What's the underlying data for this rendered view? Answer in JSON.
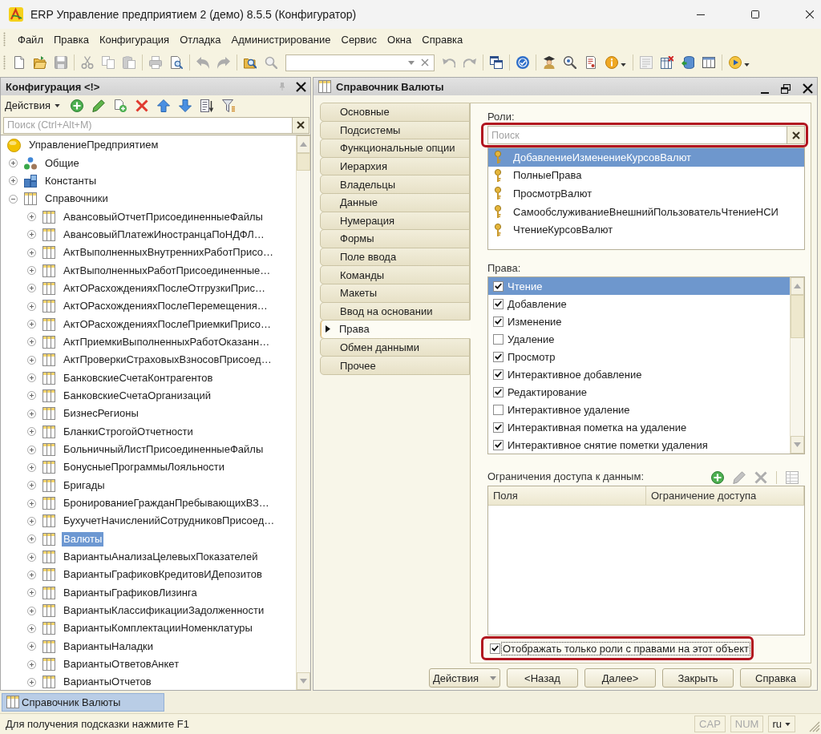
{
  "window": {
    "title": "ERP Управление предприятием 2 (демо) 8.5.5 (Конфигуратор)"
  },
  "menu": [
    "Файл",
    "Правка",
    "Конфигурация",
    "Отладка",
    "Администрирование",
    "Сервис",
    "Окна",
    "Справка"
  ],
  "toolbar": [
    [
      {
        "kind": "new",
        "disabled": false
      },
      {
        "kind": "open",
        "disabled": false
      },
      {
        "kind": "save",
        "disabled": true
      }
    ],
    [
      {
        "kind": "cut",
        "disabled": true
      },
      {
        "kind": "copy",
        "disabled": true
      },
      {
        "kind": "paste",
        "disabled": true
      }
    ],
    [
      {
        "kind": "print",
        "disabled": true
      },
      {
        "kind": "preview",
        "disabled": false
      }
    ],
    [
      {
        "kind": "undo",
        "disabled": true
      },
      {
        "kind": "redo",
        "disabled": true
      }
    ],
    [
      {
        "kind": "find_in_folder",
        "disabled": false
      },
      {
        "kind": "search",
        "disabled": true
      },
      {
        "kind": "combo",
        "disabled": false
      },
      {
        "kind": "find_prev",
        "disabled": true
      },
      {
        "kind": "find_next",
        "disabled": true
      }
    ],
    [
      {
        "kind": "windows",
        "disabled": false
      }
    ],
    [
      {
        "kind": "check",
        "disabled": false
      }
    ],
    [
      {
        "kind": "assistant",
        "disabled": false
      },
      {
        "kind": "help_search",
        "disabled": false
      },
      {
        "kind": "document",
        "disabled": false
      },
      {
        "kind": "info",
        "disabled": false
      },
      {
        "kind": "caret",
        "disabled": false
      }
    ],
    [
      {
        "kind": "module",
        "disabled": true
      },
      {
        "kind": "table_delete",
        "disabled": false
      },
      {
        "kind": "database",
        "disabled": false
      },
      {
        "kind": "form",
        "disabled": false
      }
    ],
    [
      {
        "kind": "play",
        "disabled": false
      },
      {
        "kind": "caret",
        "disabled": false
      }
    ]
  ],
  "config_panel": {
    "title": "Конфигурация <!>",
    "actions": "Действия",
    "toolbar": [
      {
        "kind": "add"
      },
      {
        "kind": "edit"
      },
      {
        "kind": "copy_add"
      },
      {
        "kind": "delete"
      },
      {
        "kind": "up"
      },
      {
        "kind": "down"
      },
      {
        "kind": "sort"
      },
      {
        "kind": "filter"
      }
    ],
    "search": {
      "placeholder": "Поиск (Ctrl+Alt+M)"
    },
    "tree": [
      {
        "label": "УправлениеПредприятием",
        "kind": "root",
        "selected": false,
        "children": [
          {
            "label": "Общие",
            "kind": "common",
            "expanded": false,
            "selected": false
          },
          {
            "label": "Константы",
            "kind": "constants",
            "expanded": false,
            "selected": false
          },
          {
            "label": "Справочники",
            "kind": "catalogs",
            "expanded": true,
            "selected": false,
            "children": [
              {
                "label": "АвансовыйОтчетПрисоединенныеФайлы",
                "kind": "catalog",
                "expanded": false,
                "selected": false
              },
              {
                "label": "АвансовыйПлатежИностранцаПоНДФЛ…",
                "kind": "catalog",
                "expanded": false,
                "selected": false
              },
              {
                "label": "АктВыполненныхВнутреннихРаботПрисо…",
                "kind": "catalog",
                "expanded": false,
                "selected": false
              },
              {
                "label": "АктВыполненныхРаботПрисоединенные…",
                "kind": "catalog",
                "expanded": false,
                "selected": false
              },
              {
                "label": "АктОРасхожденияхПослеОтгрузкиПрис…",
                "kind": "catalog",
                "expanded": false,
                "selected": false
              },
              {
                "label": "АктОРасхожденияхПослеПеремещения…",
                "kind": "catalog",
                "expanded": false,
                "selected": false
              },
              {
                "label": "АктОРасхожденияхПослеПриемкиПрисо…",
                "kind": "catalog",
                "expanded": false,
                "selected": false
              },
              {
                "label": "АктПриемкиВыполненныхРаботОказанн…",
                "kind": "catalog",
                "expanded": false,
                "selected": false
              },
              {
                "label": "АктПроверкиСтраховыхВзносовПрисоед…",
                "kind": "catalog",
                "expanded": false,
                "selected": false
              },
              {
                "label": "БанковскиеСчетаКонтрагентов",
                "kind": "catalog",
                "expanded": false,
                "selected": false
              },
              {
                "label": "БанковскиеСчетаОрганизаций",
                "kind": "catalog",
                "expanded": false,
                "selected": false
              },
              {
                "label": "БизнесРегионы",
                "kind": "catalog",
                "expanded": false,
                "selected": false
              },
              {
                "label": "БланкиСтрогойОтчетности",
                "kind": "catalog",
                "expanded": false,
                "selected": false
              },
              {
                "label": "БольничныйЛистПрисоединенныеФайлы",
                "kind": "catalog",
                "expanded": false,
                "selected": false
              },
              {
                "label": "БонусныеПрограммыЛояльности",
                "kind": "catalog",
                "expanded": false,
                "selected": false
              },
              {
                "label": "Бригады",
                "kind": "catalog",
                "expanded": false,
                "selected": false
              },
              {
                "label": "БронированиеГражданПребывающихВЗ…",
                "kind": "catalog",
                "expanded": false,
                "selected": false
              },
              {
                "label": "БухучетНачисленийСотрудниковПрисоед…",
                "kind": "catalog",
                "expanded": false,
                "selected": false
              },
              {
                "label": "Валюты",
                "kind": "catalog",
                "expanded": false,
                "selected": true
              },
              {
                "label": "ВариантыАнализаЦелевыхПоказателей",
                "kind": "catalog",
                "expanded": false,
                "selected": false
              },
              {
                "label": "ВариантыГрафиковКредитовИДепозитов",
                "kind": "catalog",
                "expanded": false,
                "selected": false
              },
              {
                "label": "ВариантыГрафиковЛизинга",
                "kind": "catalog",
                "expanded": false,
                "selected": false
              },
              {
                "label": "ВариантыКлассификацииЗадолженности",
                "kind": "catalog",
                "expanded": false,
                "selected": false
              },
              {
                "label": "ВариантыКомплектацииНоменклатуры",
                "kind": "catalog",
                "expanded": false,
                "selected": false
              },
              {
                "label": "ВариантыНаладки",
                "kind": "catalog",
                "expanded": false,
                "selected": false
              },
              {
                "label": "ВариантыОтветовАнкет",
                "kind": "catalog",
                "expanded": false,
                "selected": false
              },
              {
                "label": "ВариантыОтчетов",
                "kind": "catalog",
                "expanded": false,
                "selected": false
              }
            ]
          }
        ]
      }
    ]
  },
  "catalog_window": {
    "title": "Справочник Валюты",
    "tabs": [
      {
        "label": "Основные",
        "selected": false
      },
      {
        "label": "Подсистемы",
        "selected": false
      },
      {
        "label": "Функциональные опции",
        "selected": false
      },
      {
        "label": "Иерархия",
        "selected": false
      },
      {
        "label": "Владельцы",
        "selected": false
      },
      {
        "label": "Данные",
        "selected": false
      },
      {
        "label": "Нумерация",
        "selected": false
      },
      {
        "label": "Формы",
        "selected": false
      },
      {
        "label": "Поле ввода",
        "selected": false
      },
      {
        "label": "Команды",
        "selected": false
      },
      {
        "label": "Макеты",
        "selected": false
      },
      {
        "label": "Ввод на основании",
        "selected": false
      },
      {
        "label": "Права",
        "selected": true
      },
      {
        "label": "Обмен данными",
        "selected": false
      },
      {
        "label": "Прочее",
        "selected": false
      }
    ],
    "roles": {
      "label": "Роли:",
      "search": {
        "placeholder": "Поиск",
        "highlighted": true
      },
      "items": [
        {
          "name": "ДобавлениеИзменениеКурсовВалют",
          "selected": true
        },
        {
          "name": "ПолныеПрава",
          "selected": false
        },
        {
          "name": "ПросмотрВалют",
          "selected": false
        },
        {
          "name": "СамообслуживаниеВнешнийПользовательЧтениеНСИ",
          "selected": false
        },
        {
          "name": "ЧтениеКурсовВалют",
          "selected": false
        }
      ]
    },
    "rights": {
      "label": "Права:",
      "items": [
        {
          "name": "Чтение",
          "checked": true,
          "selected": true
        },
        {
          "name": "Добавление",
          "checked": true,
          "selected": false
        },
        {
          "name": "Изменение",
          "checked": true,
          "selected": false
        },
        {
          "name": "Удаление",
          "checked": false,
          "selected": false
        },
        {
          "name": "Просмотр",
          "checked": true,
          "selected": false
        },
        {
          "name": "Интерактивное добавление",
          "checked": true,
          "selected": false
        },
        {
          "name": "Редактирование",
          "checked": true,
          "selected": false
        },
        {
          "name": "Интерактивное удаление",
          "checked": false,
          "selected": false
        },
        {
          "name": "Интерактивная пометка на удаление",
          "checked": true,
          "selected": false
        },
        {
          "name": "Интерактивное снятие пометки удаления",
          "checked": true,
          "selected": false
        }
      ]
    },
    "restrictions": {
      "label": "Ограничения доступа к данным:",
      "toolbar": [
        [
          {
            "kind": "add",
            "disabled": false
          },
          {
            "kind": "edit",
            "disabled": true
          },
          {
            "kind": "delete",
            "disabled": true
          }
        ],
        [
          {
            "kind": "table_settings",
            "disabled": true
          }
        ]
      ],
      "columns": [
        "Поля",
        "Ограничение доступа"
      ]
    },
    "filter_option": {
      "label": "Отображать только роли с правами на этот объект",
      "checked": true,
      "focused": true,
      "highlighted": true
    },
    "buttons": [
      {
        "label": "Действия",
        "kind": "menu"
      },
      {
        "label": "<Назад",
        "kind": "plain"
      },
      {
        "label": "Далее>",
        "kind": "plain"
      },
      {
        "label": "Закрыть",
        "kind": "plain"
      },
      {
        "label": "Справка",
        "kind": "plain"
      }
    ]
  },
  "taskbar": [
    {
      "label": "Справочник Валюты",
      "selected": true
    }
  ],
  "status_bar": {
    "hint": "Для получения подсказки нажмите F1",
    "indicators": [
      {
        "label": "CAP",
        "on": false
      },
      {
        "label": "NUM",
        "on": false
      }
    ],
    "language": "ru"
  }
}
